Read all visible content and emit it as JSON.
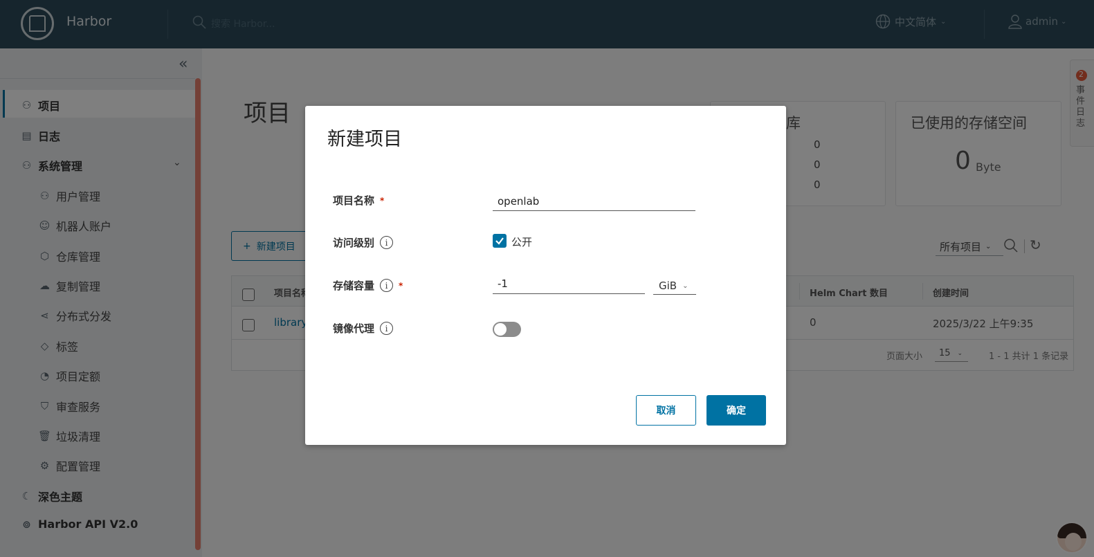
{
  "header": {
    "brand": "Harbor",
    "search_placeholder": "搜索 Harbor...",
    "language": "中文简体",
    "user": "admin"
  },
  "sidebar": {
    "items": [
      {
        "label": "项目",
        "icon": "projects-icon"
      },
      {
        "label": "日志",
        "icon": "logs-icon"
      },
      {
        "label": "系统管理",
        "icon": "admin-icon"
      },
      {
        "label": "用户管理",
        "icon": "users-icon"
      },
      {
        "label": "机器人账户",
        "icon": "robot-icon"
      },
      {
        "label": "仓库管理",
        "icon": "registry-icon"
      },
      {
        "label": "复制管理",
        "icon": "replication-icon"
      },
      {
        "label": "分布式分发",
        "icon": "distribution-icon"
      },
      {
        "label": "标签",
        "icon": "tag-icon"
      },
      {
        "label": "项目定额",
        "icon": "quota-icon"
      },
      {
        "label": "审查服务",
        "icon": "shield-icon"
      },
      {
        "label": "垃圾清理",
        "icon": "trash-icon"
      },
      {
        "label": "配置管理",
        "icon": "gear-icon"
      },
      {
        "label": "深色主题",
        "icon": "moon-icon"
      },
      {
        "label": "Harbor API V2.0",
        "icon": "api-icon"
      }
    ]
  },
  "main": {
    "title": "项目",
    "card_repo_title": "库",
    "repo_counts": [
      "0",
      "0",
      "0"
    ],
    "card_storage_title": "已使用的存储空间",
    "storage_value": "0",
    "storage_unit": "Byte",
    "new_project_button": "新建项目",
    "filter_label": "所有项目",
    "table": {
      "headers": [
        "项目名称",
        "Helm Chart 数目",
        "创建时间"
      ],
      "rows": [
        {
          "name": "library",
          "helm_count": "0",
          "created": "2025/3/22 上午9:35"
        }
      ],
      "page_size_label": "页面大小",
      "page_size": "15",
      "summary": "1 - 1 共计 1 条记录"
    }
  },
  "side_tab": {
    "badge": "2",
    "label": "事件日志"
  },
  "modal": {
    "title": "新建项目",
    "fields": {
      "name_label": "项目名称",
      "name_value": "openlab",
      "access_label": "访问级别",
      "access_checkbox_label": "公开",
      "access_checked": true,
      "quota_label": "存储容量",
      "quota_value": "-1",
      "quota_unit": "GiB",
      "proxy_label": "镜像代理",
      "proxy_enabled": false
    },
    "cancel_button": "取消",
    "ok_button": "确定"
  },
  "colors": {
    "header_bg": "#2d4a5a",
    "accent": "#0072a3",
    "required": "#c92100"
  }
}
